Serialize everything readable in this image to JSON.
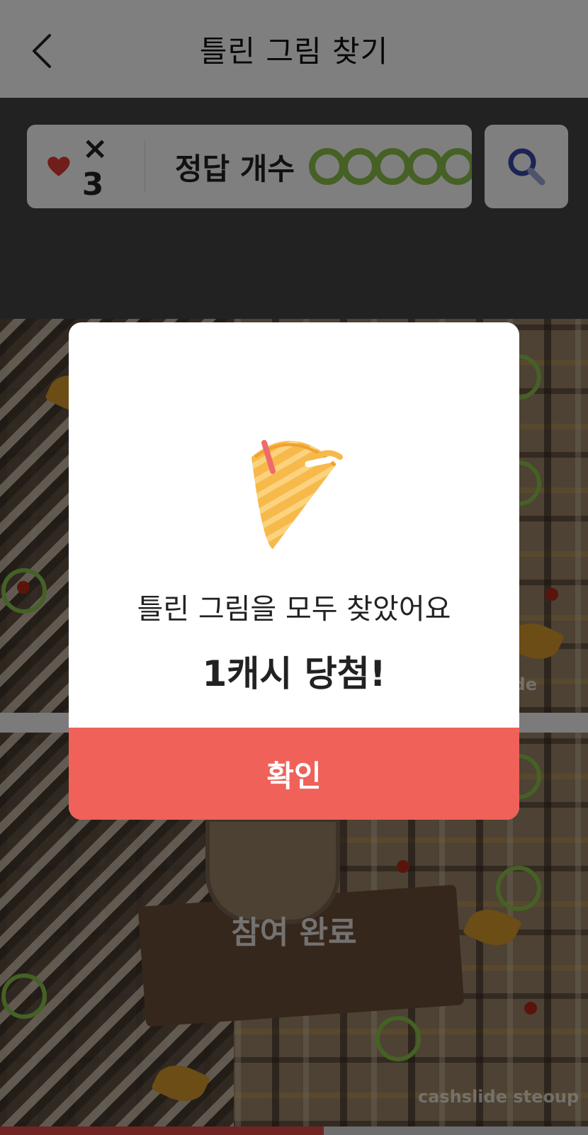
{
  "header": {
    "title": "틀린 그림 찾기",
    "back_icon": "chevron-left-icon"
  },
  "status": {
    "heart_icon": "heart-icon",
    "lives": "× 3",
    "answer_label": "정답 개수",
    "answer_marks": 5,
    "answer_color": "#8bc34a",
    "search_icon": "magnifier-icon"
  },
  "second_picture": {
    "status_text": "참여 완료"
  },
  "watermark": "cashslide steoup",
  "progress": {
    "fraction": 0.55,
    "color": "#e04a44"
  },
  "modal": {
    "illustration": "cone-party-popper-icon",
    "message": "틀린 그림을 모두 찾았어요",
    "prize": "1캐시 당첨!",
    "confirm_label": "확인",
    "confirm_color": "#ef6159"
  }
}
